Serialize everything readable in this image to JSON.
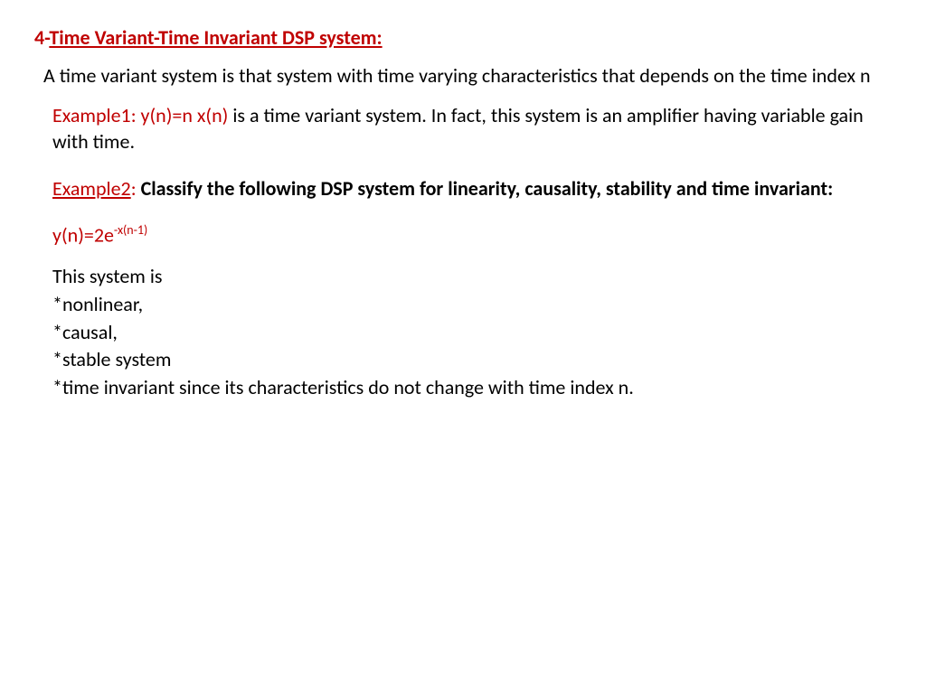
{
  "heading": {
    "num": "4-",
    "title": "Time Variant-Time Invariant DSP system:"
  },
  "intro": "A time variant system is that system with time varying characteristics that depends on the time index n",
  "example1": {
    "label": "Example1:  y(n)=n x(n) ",
    "rest": "is a time variant system. In fact, this system is an amplifier having variable gain with time."
  },
  "example2": {
    "label": "Example2",
    "colon": ":  ",
    "question": "Classify the following DSP system for linearity, causality, stability and time invariant:"
  },
  "formula": {
    "base": "y(n)=2e",
    "exp": "-x(n-1)"
  },
  "answer": {
    "l1": "This system is",
    "l2": "*nonlinear,",
    "l3": "*causal,",
    "l4": "*stable system",
    "l5": "*time invariant since its characteristics do not change with time index n."
  }
}
